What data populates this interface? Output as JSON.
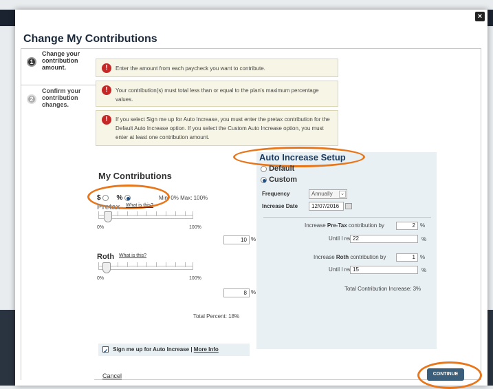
{
  "window": {
    "close_glyph": "×"
  },
  "modal": {
    "title": "Change My Contributions"
  },
  "steps": [
    {
      "number": "1",
      "label": "Change your contribution amount."
    },
    {
      "number": "2",
      "label": "Confirm your contribution changes."
    }
  ],
  "alerts": [
    {
      "icon": "!",
      "text": "Enter the amount from each paycheck you want to contribute."
    },
    {
      "icon": "!",
      "text": "Your contribution(s) must total less than or equal to the plan's maximum percentage values."
    },
    {
      "icon": "!",
      "text": "If you select Sign me up for Auto Increase, you must enter the pretax contribution for the Default Auto Increase option. If you select the Custom Auto Increase option, you must enter at least one contribution amount."
    }
  ],
  "contributions": {
    "title": "My Contributions",
    "toggle": {
      "dollar_label": "$",
      "percent_label": "%",
      "selected": "percent"
    },
    "min_max": "Min: 0%  Max: 100%",
    "pretax": {
      "label": "Pretax",
      "what_is": "What is this?",
      "min": "0%",
      "max": "100%",
      "value": "10",
      "unit": "%",
      "level": 0.1
    },
    "roth": {
      "label": "Roth",
      "what_is": "What is this?",
      "min": "0%",
      "max": "100%",
      "value": "8",
      "unit": "%",
      "level": 0.08
    },
    "total_percent": "Total Percent: 18%"
  },
  "auto_increase": {
    "title": "Auto Increase Setup",
    "options": [
      {
        "label": "Default",
        "selected": false
      },
      {
        "label": "Custom",
        "selected": true
      }
    ],
    "frequency_label": "Frequency",
    "frequency_value": "Annually",
    "increase_date_label": "Increase Date",
    "increase_date_value": "12/07/2016",
    "pretax_prefix": "Increase ",
    "pretax_bold": "Pre-Tax",
    "pretax_suffix": " contribution by",
    "pretax_by_value": "2",
    "pretax_until_label": "Until I reach",
    "pretax_until_value": "22",
    "roth_prefix": "Increase ",
    "roth_bold": "Roth",
    "roth_suffix": " contribution by",
    "roth_by_value": "1",
    "roth_until_label": "Until I reach",
    "roth_until_value": "15",
    "pct": "%",
    "total": "Total Contribution Increase: 3%"
  },
  "footer": {
    "auto_signup_label": "Sign me up for Auto Increase",
    "separator": "|",
    "more_info": "More Info",
    "cancel": "Cancel",
    "continue": "CONTINUE"
  },
  "colors": {
    "accent": "#e8761b",
    "button": "#3b5e7b",
    "panel": "#e8f0f3",
    "alert_bg": "#f7f5e5",
    "alert_icon": "#c62828"
  }
}
